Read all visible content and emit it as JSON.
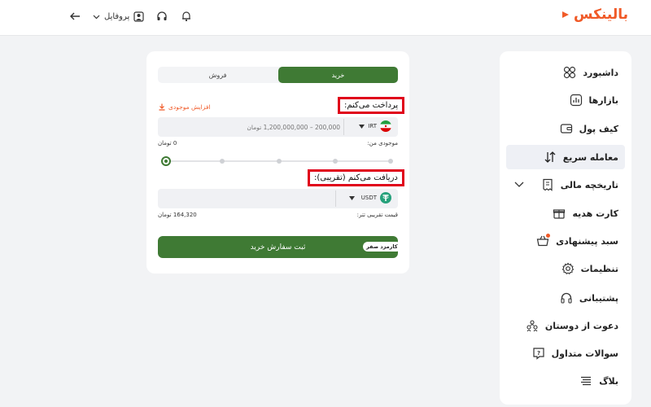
{
  "header": {
    "logo_text": "بالینکس",
    "profile_label": "پروفایل",
    "accent": "#f05a28"
  },
  "sidebar": {
    "items": [
      {
        "label": "داشبورد",
        "icon": "dashboard-icon"
      },
      {
        "label": "بازارها",
        "icon": "markets-icon"
      },
      {
        "label": "کیف پول",
        "icon": "wallet-icon"
      },
      {
        "label": "معامله سریع",
        "icon": "swap-icon",
        "active": true
      },
      {
        "label": "تاریخچه مالی",
        "icon": "history-icon"
      },
      {
        "label": "کارت هدیه",
        "icon": "gift-icon"
      },
      {
        "label": "سبد پیشنهادی",
        "icon": "basket-icon"
      },
      {
        "label": "تنظیمات",
        "icon": "gear-icon"
      },
      {
        "label": "پشتیبانی",
        "icon": "headset-icon"
      },
      {
        "label": "دعوت از دوستان",
        "icon": "invite-icon"
      },
      {
        "label": "سوالات متداول",
        "icon": "faq-icon"
      },
      {
        "label": "بلاگ",
        "icon": "blog-icon"
      }
    ]
  },
  "trade": {
    "tab_buy": "خرید",
    "tab_sell": "فروش",
    "pay_label": "پرداخت می‌کنم:",
    "add_balance": "افزایش موجودی",
    "pay_placeholder": "200,000 – 1,200,000,000 تومان",
    "pay_currency": "IRT",
    "balance_label": "موجودی من:",
    "balance_value": "0 تومان",
    "receive_label": "دریافت می‌کنم (تقریبی):",
    "receive_currency": "USDT",
    "price_label": "قیمت تقریبی تتر:",
    "price_value": "164,320 تومان",
    "submit_label": "ثبت سفارش خرید",
    "fee_badge": "کارمزد صفر",
    "slider_fraction": 0,
    "brand_green": "#3f7a34"
  }
}
